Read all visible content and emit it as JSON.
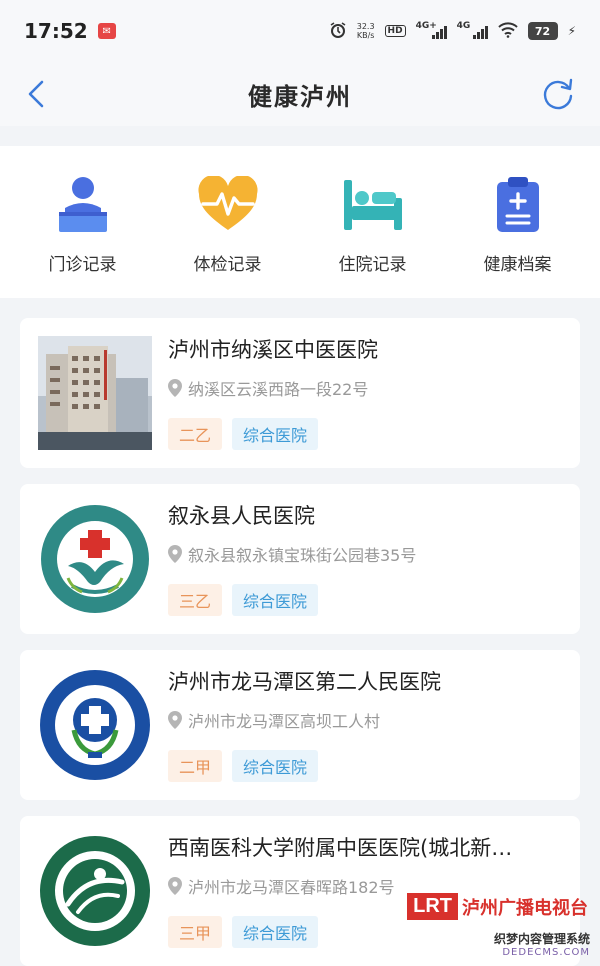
{
  "status_bar": {
    "time": "17:52",
    "notif_icon": "app-notification-icon",
    "speed_value": "32.3",
    "speed_unit": "KB/s",
    "hd_badge": "HD",
    "signal_1_label": "4G+",
    "signal_2_label": "4G",
    "battery": "72"
  },
  "header": {
    "title": "健康泸州",
    "back_icon": "chevron-left-icon",
    "refresh_icon": "refresh-icon",
    "accent_color": "#3b7ad9"
  },
  "quick_menu": [
    {
      "label": "门诊记录",
      "icon": "outpatient-icon"
    },
    {
      "label": "体检记录",
      "icon": "heartbeat-icon"
    },
    {
      "label": "住院记录",
      "icon": "hospital-bed-icon"
    },
    {
      "label": "健康档案",
      "icon": "clipboard-icon"
    }
  ],
  "hospitals": [
    {
      "name": "泸州市纳溪区中医医院",
      "address": "纳溪区云溪西路一段22号",
      "level": "二乙",
      "type": "综合医院",
      "logo": "hospital-building-photo"
    },
    {
      "name": "叙永县人民医院",
      "address": "叙永县叙永镇宝珠街公园巷35号",
      "level": "三乙",
      "type": "综合医院",
      "logo": "xuyong-hospital-logo"
    },
    {
      "name": "泸州市龙马潭区第二人民医院",
      "address": "泸州市龙马潭区高坝工人村",
      "level": "二甲",
      "type": "综合医院",
      "logo": "longmatan-hospital-logo"
    },
    {
      "name": "西南医科大学附属中医医院(城北新…",
      "address": "泸州市龙马潭区春晖路182号",
      "level": "三甲",
      "type": "综合医院",
      "logo": "southwest-medical-tcm-logo"
    }
  ],
  "watermark": {
    "brand": "LRT",
    "name": "泸州广播电视台",
    "footer_line1": "织梦内容管理系统",
    "footer_line2": "DEDECMS.COM"
  },
  "colors": {
    "level_tag_bg": "#fdf0e6",
    "level_tag_text": "#e8945a",
    "type_tag_bg": "#e9f4fb",
    "type_tag_text": "#3d9ad6"
  }
}
